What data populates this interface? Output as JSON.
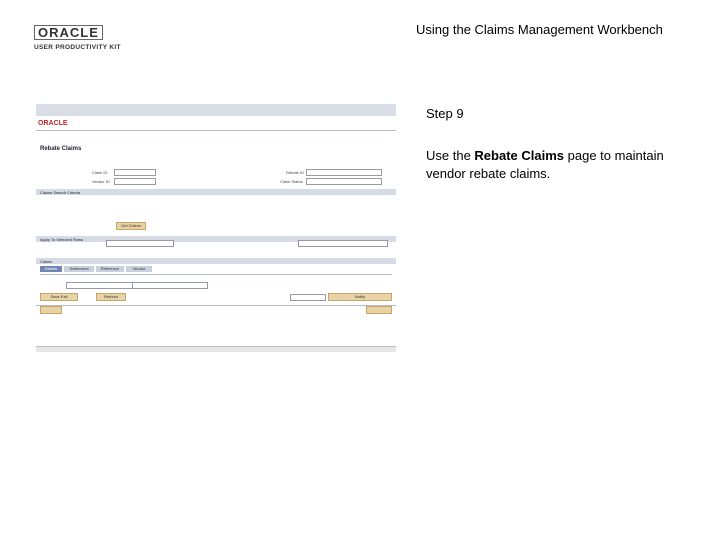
{
  "header": {
    "logo_name": "ORACLE",
    "logo_sub": "USER PRODUCTIVITY KIT",
    "title": "Using the Claims Management Workbench"
  },
  "step": {
    "label": "Step 9"
  },
  "description": {
    "prefix": "Use the ",
    "bold": "Rebate Claims",
    "suffix": " page to maintain vendor rebate claims."
  },
  "screenshot": {
    "page_heading": "Rebate Claims",
    "section_search": "Claims Search Criteria",
    "section_apply": "Apply To Selected Rows",
    "section_claims": "Claims",
    "field_claim_id": "Claim ID",
    "field_vendor_id": "Vendor ID",
    "field_rebate_id": "Rebate ID",
    "field_claim_status": "Claim Status",
    "button_get_claims": "Get Claims",
    "button_save_exit": "Save Exit",
    "button_refresh": "Refresh",
    "button_notify": "Notify",
    "tab_labels": [
      "Details",
      "Settlement",
      "Reference",
      "Vendor"
    ]
  }
}
